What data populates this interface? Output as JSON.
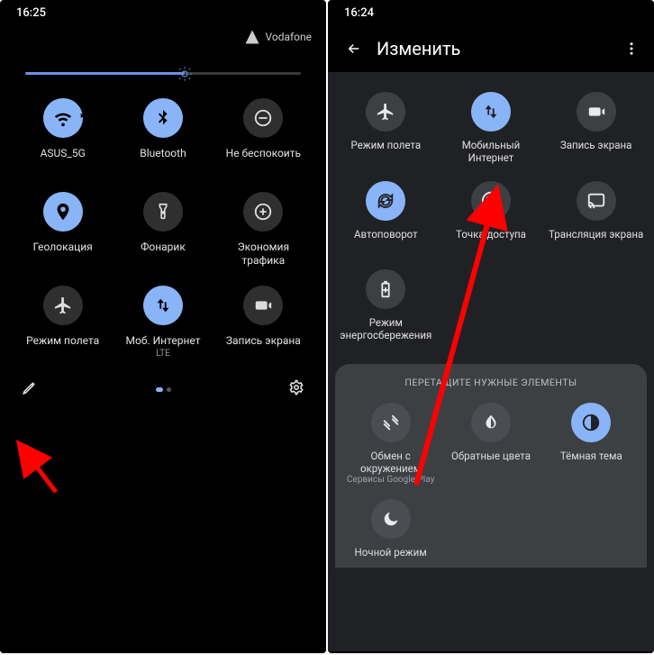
{
  "left": {
    "time": "16:25",
    "carrier": "Vodafone",
    "brightness_pct": 58,
    "tiles": [
      {
        "name": "wifi",
        "label": "ASUS_5G",
        "on": true
      },
      {
        "name": "bluetooth",
        "label": "Bluetooth",
        "on": true
      },
      {
        "name": "dnd",
        "label": "Не беспокоить",
        "on": false
      },
      {
        "name": "location",
        "label": "Геолокация",
        "on": true
      },
      {
        "name": "flashlight",
        "label": "Фонарик",
        "on": false
      },
      {
        "name": "data-saver",
        "label": "Экономия трафика",
        "on": false
      },
      {
        "name": "airplane",
        "label": "Режим полета",
        "on": false
      },
      {
        "name": "mobile-data",
        "label": "Моб. Интернет",
        "sub": "LTE",
        "on": true
      },
      {
        "name": "screen-record",
        "label": "Запись экрана",
        "on": false
      }
    ],
    "page_index": 0,
    "page_count": 2
  },
  "right": {
    "time": "16:24",
    "title": "Изменить",
    "tiles_top": [
      {
        "name": "airplane",
        "label": "Режим полета",
        "on": false
      },
      {
        "name": "mobile-data",
        "label": "Мобильный Интернет",
        "on": true
      },
      {
        "name": "screen-record",
        "label": "Запись экрана",
        "on": false
      },
      {
        "name": "auto-rotate",
        "label": "Автоповорот",
        "on": true
      },
      {
        "name": "hotspot",
        "label": "Точка доступа",
        "on": false
      },
      {
        "name": "cast",
        "label": "Трансляция экрана",
        "on": false
      },
      {
        "name": "battery-saver",
        "label": "Режим энергосбережения",
        "on": false
      }
    ],
    "drag_hint": "ПЕРЕТАЩИТЕ НУЖНЫЕ ЭЛЕМЕНТЫ",
    "tiles_bottom": [
      {
        "name": "nearby-share",
        "label": "Обмен с окружением",
        "sub": "Сервисы Google Play",
        "on": false
      },
      {
        "name": "invert-colors",
        "label": "Обратные цвета",
        "on": false
      },
      {
        "name": "dark-theme",
        "label": "Тёмная тема",
        "on": true
      },
      {
        "name": "night-light",
        "label": "Ночной режим",
        "on": false
      }
    ]
  },
  "colors": {
    "accent": "#8ab4f8",
    "arrow": "#ff0000",
    "panel_bg": "#000000",
    "edit_bg": "#202124"
  }
}
